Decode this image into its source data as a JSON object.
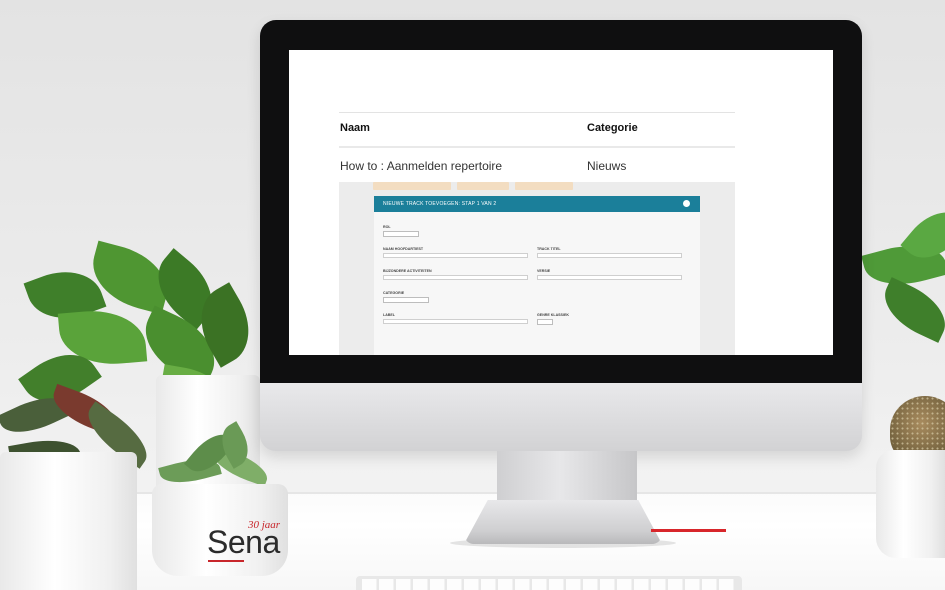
{
  "screen": {
    "table": {
      "headers": [
        "Naam",
        "Categorie"
      ],
      "rows": [
        {
          "naam": "How to : Aanmelden repertoire",
          "categorie": "Nieuws"
        }
      ]
    },
    "embedded_form": {
      "title": "NIEUWE TRACK TOEVOEGEN: STAP 1 VAN 2",
      "accent_color": "#1b7f9a",
      "fields": [
        {
          "label": "ROL"
        },
        {
          "label": "NAAM HOOFDARTIEST"
        },
        {
          "label": "TRACK TITEL"
        },
        {
          "label": "BIJZONDERE ACTIVITEITEN"
        },
        {
          "label": "VERSIE"
        },
        {
          "label": "CATEGORIE"
        },
        {
          "label": "LABEL"
        },
        {
          "label": "GENRE KLASSIEK"
        }
      ]
    }
  },
  "logo": {
    "name": "Sena",
    "anniversary": "30 jaar",
    "brand_color": "#c8262b"
  }
}
